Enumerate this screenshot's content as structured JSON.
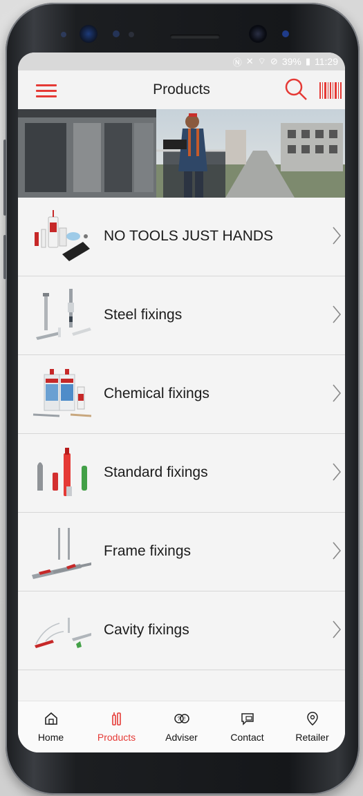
{
  "status_bar": {
    "battery": "39%",
    "time": "11:29"
  },
  "app_bar": {
    "title": "Products"
  },
  "products": [
    {
      "label": "NO TOOLS JUST HANDS",
      "icon": "adhesive-kit-image"
    },
    {
      "label": "Steel fixings",
      "icon": "steel-bolt-image"
    },
    {
      "label": "Chemical fixings",
      "icon": "chemical-cartridge-image"
    },
    {
      "label": "Standard fixings",
      "icon": "wall-plug-image"
    },
    {
      "label": "Frame fixings",
      "icon": "frame-anchor-image"
    },
    {
      "label": "Cavity fixings",
      "icon": "cavity-anchor-image"
    }
  ],
  "tabs": [
    {
      "label": "Home",
      "icon": "home-icon",
      "active": false
    },
    {
      "label": "Products",
      "icon": "products-icon",
      "active": true
    },
    {
      "label": "Adviser",
      "icon": "adviser-icon",
      "active": false
    },
    {
      "label": "Contact",
      "icon": "contact-icon",
      "active": false
    },
    {
      "label": "Retailer",
      "icon": "location-pin-icon",
      "active": false
    }
  ],
  "colors": {
    "accent": "#e53935",
    "text": "#1b1b1b",
    "list_bg": "#f4f4f4"
  }
}
